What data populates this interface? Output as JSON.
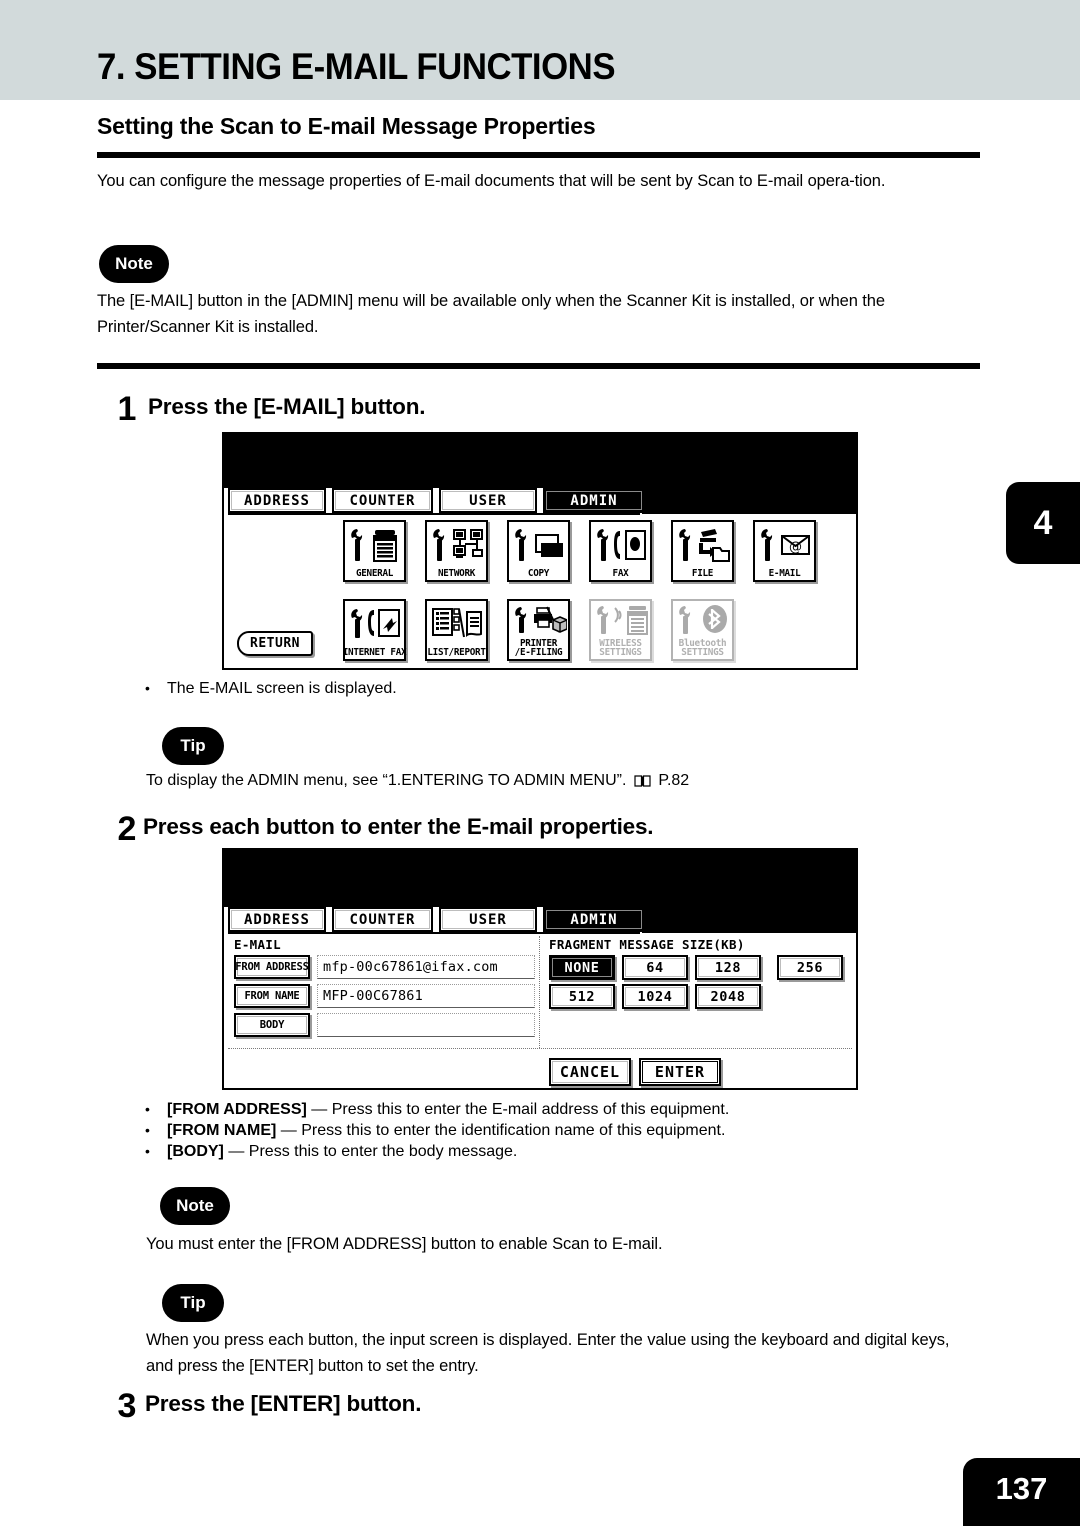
{
  "chapter": {
    "title": "7. SETTING E-MAIL FUNCTIONS"
  },
  "section": {
    "title": "Setting the Scan to E-mail Message Properties"
  },
  "intro": "You can configure the message properties of E-mail documents that will be sent by Scan to E-mail opera-tion.",
  "note1": {
    "badge": "Note",
    "text": "The [E-MAIL] button in the [ADMIN] menu will be available only when the Scanner Kit is installed, or when the Printer/Scanner Kit is installed."
  },
  "step1": {
    "number": "1",
    "text": "Press the [E-MAIL] button.",
    "bullet": "The E-MAIL screen is displayed."
  },
  "tip1": {
    "badge": "Tip",
    "text_before": "To display the ADMIN menu, see “1.ENTERING TO ADMIN MENU”.",
    "page_ref": "P.82"
  },
  "step2": {
    "number": "2",
    "text": "Press each button to enter the E-mail properties.",
    "bullets": [
      {
        "key": "[FROM ADDRESS]",
        "desc": "— Press this to enter the E-mail address of this equipment."
      },
      {
        "key": "[FROM NAME]",
        "desc": "— Press this to enter the identification name of this equipment."
      },
      {
        "key": "[BODY]",
        "desc": "— Press this to enter the body message."
      }
    ]
  },
  "note2": {
    "badge": "Note",
    "text": "You must enter the [FROM ADDRESS] button to enable Scan to E-mail."
  },
  "tip2": {
    "badge": "Tip",
    "text": "When you press each button, the input screen is displayed.  Enter the value using the keyboard and digital keys, and press the [ENTER] button to set the entry."
  },
  "step3": {
    "number": "3",
    "text": "Press the [ENTER] button."
  },
  "side_tab": {
    "label": "4"
  },
  "page_number": "137",
  "panel1": {
    "tabs": [
      {
        "label": "ADDRESS",
        "selected": false
      },
      {
        "label": "COUNTER",
        "selected": false
      },
      {
        "label": "USER",
        "selected": false
      },
      {
        "label": "ADMIN",
        "selected": true
      }
    ],
    "return_label": "RETURN",
    "icons_row1": [
      {
        "label": "GENERAL",
        "icon": "wrench-copier-icon",
        "disabled": false
      },
      {
        "label": "NETWORK",
        "icon": "wrench-network-icon",
        "disabled": false
      },
      {
        "label": "COPY",
        "icon": "wrench-copy-icon",
        "disabled": false
      },
      {
        "label": "FAX",
        "icon": "wrench-fax-icon",
        "disabled": false
      },
      {
        "label": "FILE",
        "icon": "wrench-file-icon",
        "disabled": false
      },
      {
        "label": "E-MAIL",
        "icon": "wrench-email-icon",
        "disabled": false
      }
    ],
    "icons_row2": [
      {
        "label": "INTERNET FAX",
        "icon": "wrench-internetfax-icon",
        "disabled": false
      },
      {
        "label": "LIST/REPORT",
        "icon": "list-report-icon",
        "disabled": false
      },
      {
        "label": "PRINTER\n/E-FILING",
        "icon": "wrench-printer-efiling-icon",
        "disabled": false
      },
      {
        "label": "WIRELESS\nSETTINGS",
        "icon": "wrench-wireless-icon",
        "disabled": true
      },
      {
        "label": "Bluetooth\nSETTINGS",
        "icon": "wrench-bluetooth-icon",
        "disabled": true
      }
    ]
  },
  "panel2": {
    "tabs": [
      {
        "label": "ADDRESS",
        "selected": false
      },
      {
        "label": "COUNTER",
        "selected": false
      },
      {
        "label": "USER",
        "selected": false
      },
      {
        "label": "ADMIN",
        "selected": true
      }
    ],
    "group_label": "E-MAIL",
    "fields": [
      {
        "button": "FROM ADDRESS",
        "value": "mfp-00c67861@ifax.com"
      },
      {
        "button": "FROM NAME",
        "value": "MFP-00C67861"
      },
      {
        "button": "BODY",
        "value": ""
      }
    ],
    "fragment": {
      "label": "FRAGMENT MESSAGE SIZE(KB)",
      "options": [
        {
          "label": "NONE",
          "selected": true
        },
        {
          "label": "64",
          "selected": false
        },
        {
          "label": "128",
          "selected": false
        },
        {
          "label": "256",
          "selected": false
        },
        {
          "label": "512",
          "selected": false
        },
        {
          "label": "1024",
          "selected": false
        },
        {
          "label": "2048",
          "selected": false
        }
      ]
    },
    "cancel_label": "CANCEL",
    "enter_label": "ENTER"
  }
}
